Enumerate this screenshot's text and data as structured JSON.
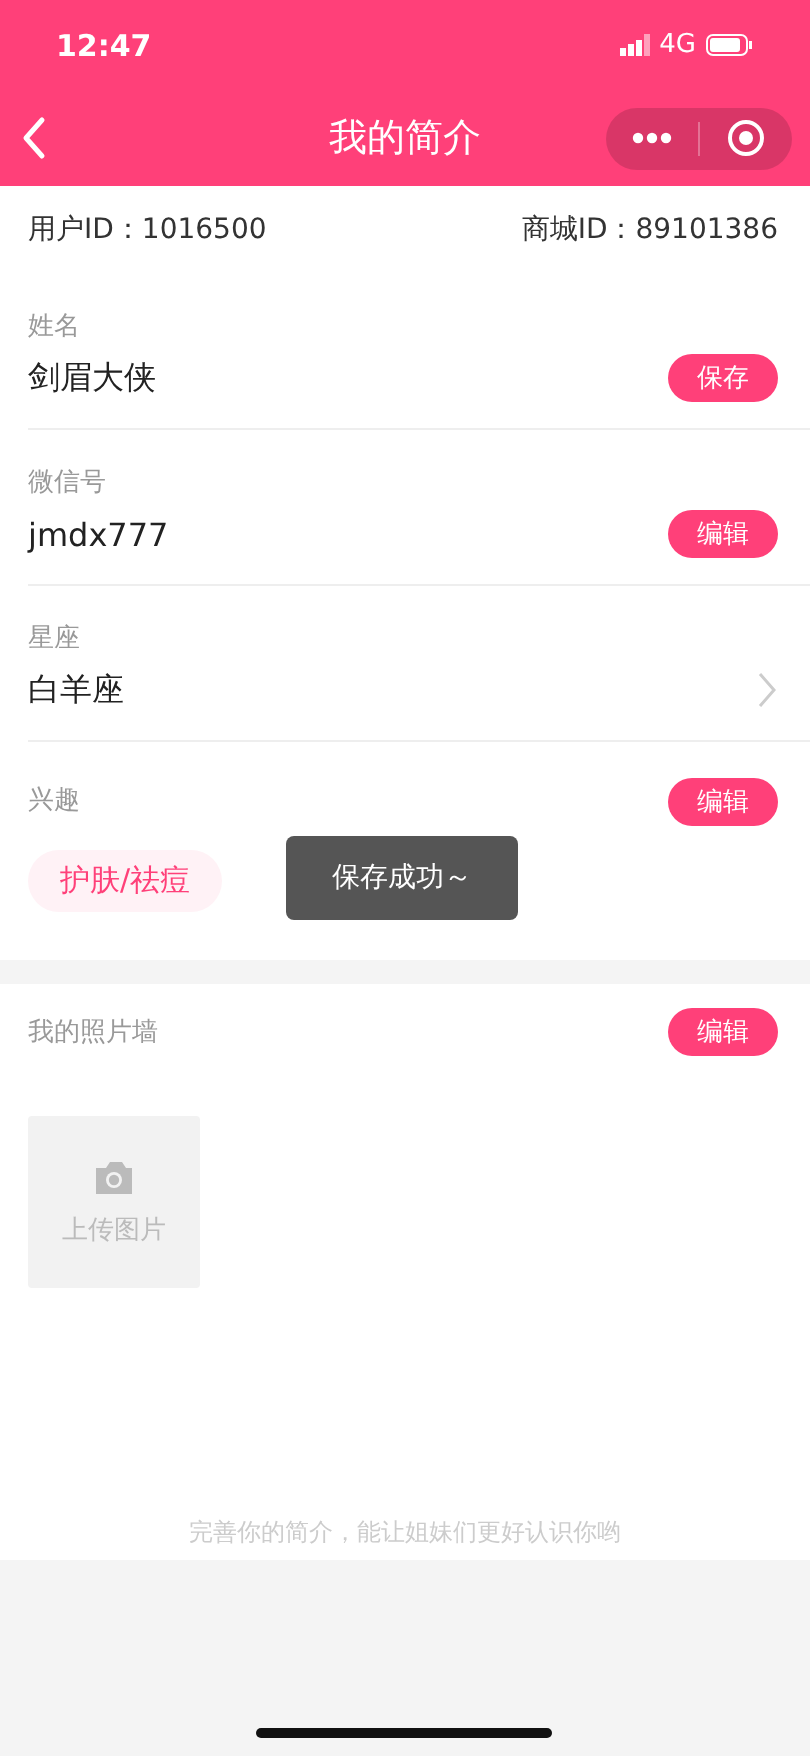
{
  "status_bar": {
    "time": "12:47",
    "network": "4G"
  },
  "nav": {
    "title": "我的简介"
  },
  "ids": [
    "用户ID：1016500",
    "商城ID：89101386"
  ],
  "fields": [
    {
      "label": "姓名",
      "value": "剑眉大侠",
      "kind": "button",
      "action": "保存"
    },
    {
      "label": "微信号",
      "value": "jmdx777",
      "kind": "button",
      "action": "编辑"
    },
    {
      "label": "星座",
      "value": "白羊座",
      "kind": "chevron"
    }
  ],
  "interests": {
    "label": "兴趣",
    "action": "编辑",
    "tags": [
      "护肤/祛痘"
    ]
  },
  "toast": "保存成功～",
  "photo_wall": {
    "title": "我的照片墙",
    "action": "编辑",
    "upload_label": "上传图片"
  },
  "footer_hint": "完善你的简介，能让姐妹们更好认识你哟"
}
